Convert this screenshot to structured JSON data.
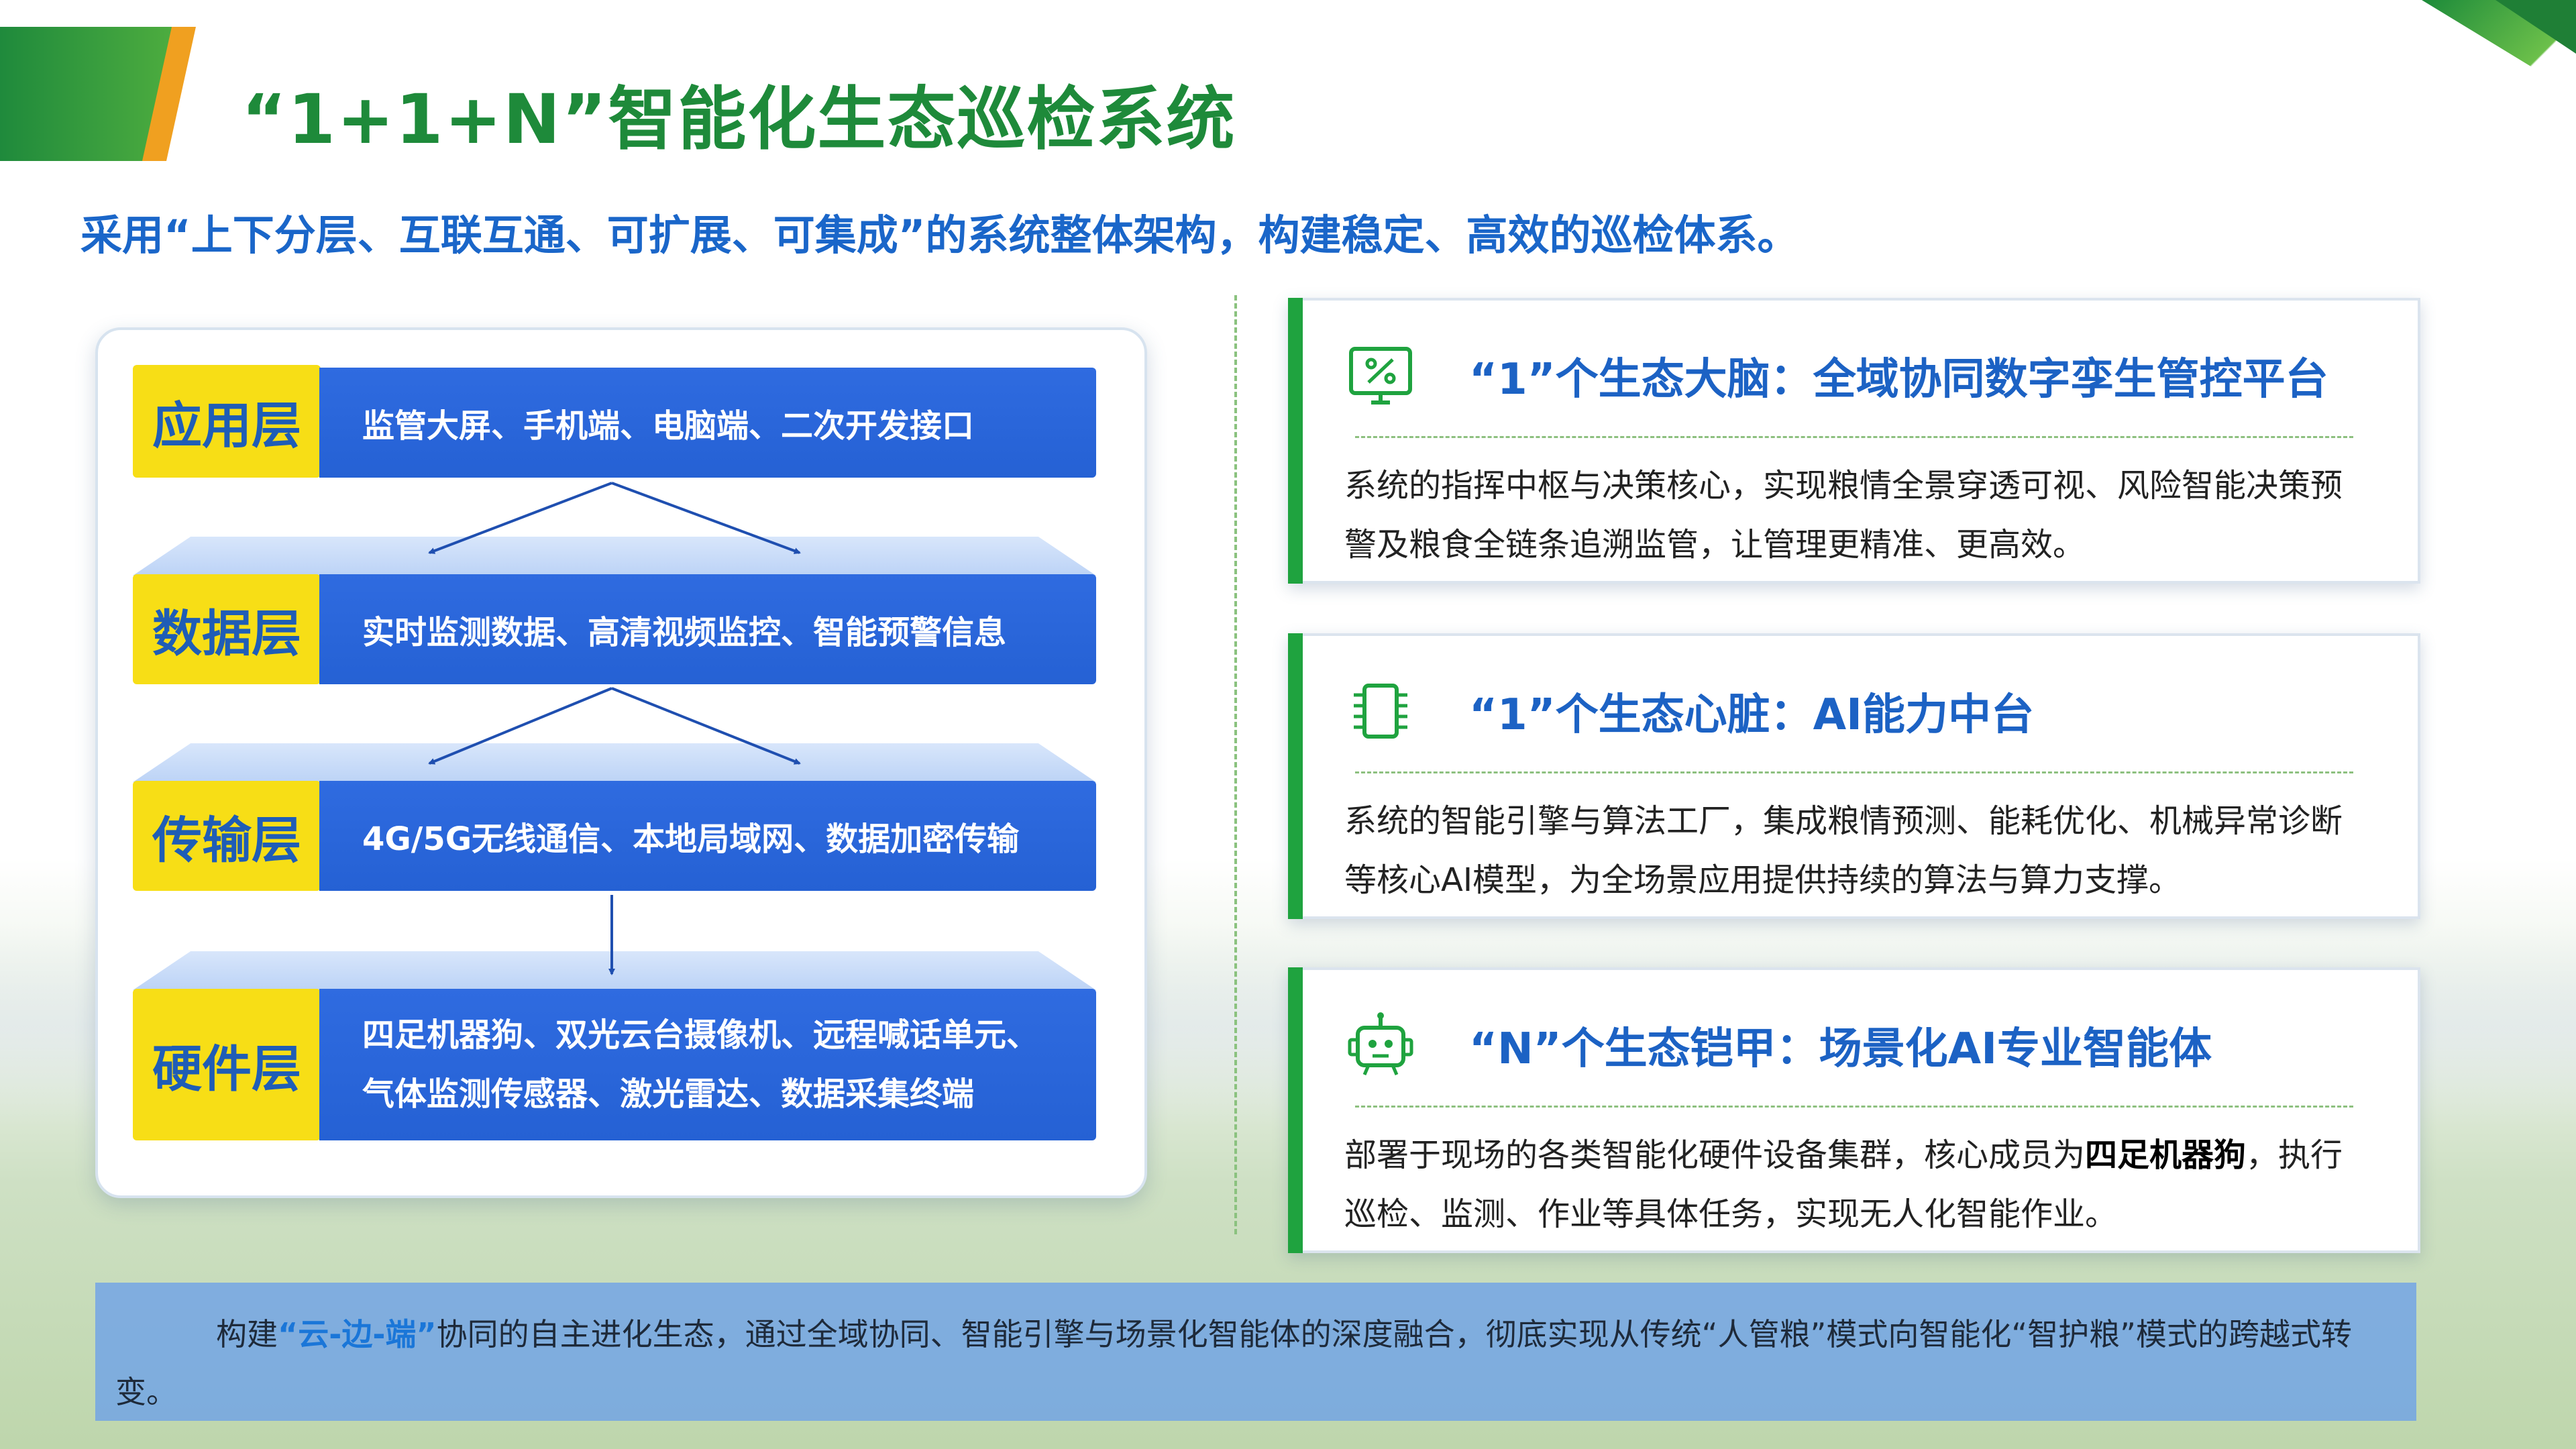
{
  "header": {
    "title": "“1+1+N”智能化生态巡检系统",
    "subtitle": "采用“上下分层、互联互通、可扩展、可集成”的系统整体架构，构建稳定、高效的巡检体系。"
  },
  "layers": [
    {
      "label": "应用层",
      "desc": "监管大屏、手机端、电脑端、二次开发接口"
    },
    {
      "label": "数据层",
      "desc": "实时监测数据、高清视频监控、智能预警信息"
    },
    {
      "label": "传输层",
      "desc": "4G/5G无线通信、本地局域网、数据加密传输"
    },
    {
      "label": "硬件层",
      "desc_line1": "四足机器狗、双光云台摄像机、远程喊话单元、",
      "desc_line2": "气体监测传感器、激光雷达、数据采集终端"
    }
  ],
  "cards": [
    {
      "icon": "monitor-percent-icon",
      "title": "“1”个生态大脑：全域协同数字孪生管控平台",
      "body": "系统的指挥中枢与决策核心，实现粮情全景穿透可视、风险智能决策预警及粮食全链条追溯监管，让管理更精准、更高效。"
    },
    {
      "icon": "chip-icon",
      "title": "“1”个生态心脏：AI能力中台",
      "body": "系统的智能引擎与算法工厂，集成粮情预测、能耗优化、机械异常诊断等核心AI模型，为全场景应用提供持续的算法与算力支撑。"
    },
    {
      "icon": "robot-icon",
      "title": "“N”个生态铠甲：场景化AI专业智能体",
      "body_pre": "部署于现场的各类智能化硬件设备集群，核心成员为",
      "body_bold": "四足机器狗",
      "body_post": "，执行巡检、监测、作业等具体任务，实现无人化智能作业。"
    }
  ],
  "banner": {
    "pre": "构建",
    "highlight": "“云-边-端”",
    "post": "协同的自主进化生态，通过全域协同、智能引擎与场景化智能体的深度融合，彻底实现从传统“人管粮”模式向智能化“智护粮”模式的跨越式转变。"
  },
  "colors": {
    "title_green": "#1e8a3a",
    "accent_blue": "#1c62c4",
    "layer_yellow": "#f7de16",
    "bar_blue": "#2f6be0",
    "card_accent_green": "#1fa33f"
  }
}
